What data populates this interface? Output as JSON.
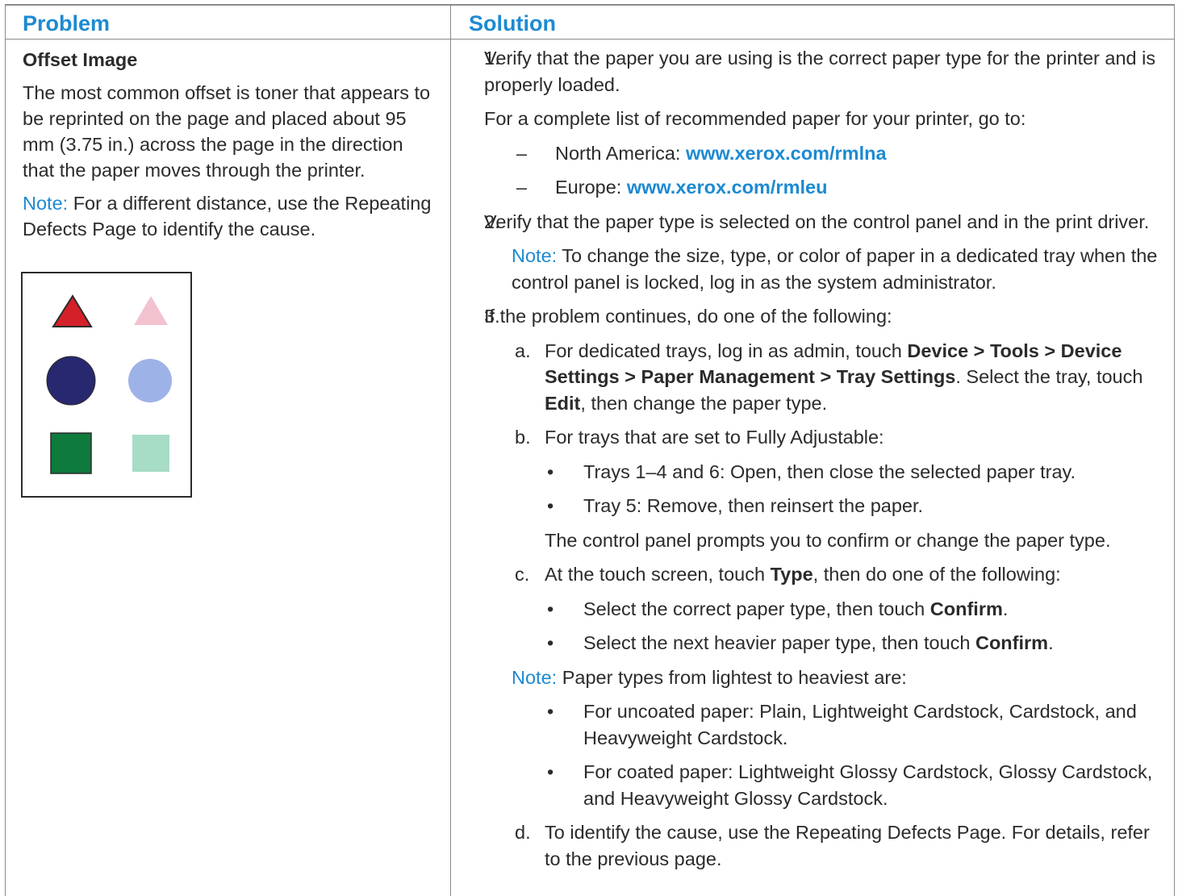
{
  "headers": {
    "problem": "Problem",
    "solution": "Solution"
  },
  "problem": {
    "title": "Offset Image",
    "description": "The most common offset is toner that appears to be reprinted on the page and placed about 95 mm (3.75 in.) across the page in the direction that the paper moves through the printer.",
    "note_label": "Note:",
    "note_text": " For a different distance, use the Repeating Defects Page to identify the cause."
  },
  "figure_colors": {
    "triangle": "#d42029",
    "triangle_ghost": "#f2c3cf",
    "circle": "#27286f",
    "circle_ghost": "#9db2e6",
    "square": "#0e7a3c",
    "square_ghost": "#a7dcc6"
  },
  "solution": {
    "s1_num": "1.",
    "s1_text": "Verify that the paper you are using is the correct paper type for the printer and is properly loaded.",
    "s1_list_intro": "For a complete list of recommended paper for your printer, go to:",
    "dash": "–",
    "na_label": "North America: ",
    "na_link": "www.xerox.com/rmlna",
    "eu_label": "Europe: ",
    "eu_link": "www.xerox.com/rmleu",
    "s2_num": "2.",
    "s2_text": "Verify that the paper type is selected on the control panel and in the print driver.",
    "note_label": "Note:",
    "s2_note": " To change the size, type, or color of paper in a dedicated tray when the control panel is locked, log in as the system administrator.",
    "s3_num": "3.",
    "s3_text": "If the problem continues, do one of the following:",
    "a_letter": "a.",
    "a_t1": "For dedicated trays, log in as admin, touch ",
    "a_b1": "Device",
    "a_t2": " > ",
    "a_b2": "Tools",
    "a_t3": " > ",
    "a_b3": "Device Settings",
    "a_t4": " > ",
    "a_b4": "Paper Management",
    "a_t5": " > ",
    "a_b5": "Tray Settings",
    "a_t6": ". Select the tray, touch ",
    "a_b6": "Edit",
    "a_t7": ", then change the paper type.",
    "b_letter": "b.",
    "b_text": "For trays that are set to Fully Adjustable:",
    "bullet": "•",
    "b_bullet1": "Trays 1–4 and 6: Open, then close the selected paper tray.",
    "b_bullet2": "Tray 5: Remove, then reinsert the paper.",
    "b_after": "The control panel prompts you to confirm or change the paper type.",
    "c_letter": "c.",
    "c_t1": "At the touch screen, touch ",
    "c_b1": "Type",
    "c_t2": ", then do one of the following:",
    "c_bullet1_t": "Select the correct paper type, then touch ",
    "c_bullet1_b": "Confirm",
    "c_bullet2_t": "Select the next heavier paper type, then touch ",
    "c_bullet2_b": "Confirm",
    "period": ".",
    "s3_note": " Paper types from lightest to heaviest are:",
    "n_bullet1": "For uncoated paper: Plain, Lightweight Cardstock, Cardstock, and Heavyweight Cardstock.",
    "n_bullet2": "For coated paper: Lightweight Glossy Cardstock, Glossy Cardstock, and Heavyweight Glossy Cardstock.",
    "d_letter": "d.",
    "d_text": "To identify the cause, use the Repeating Defects Page. For details, refer to the previous page."
  }
}
